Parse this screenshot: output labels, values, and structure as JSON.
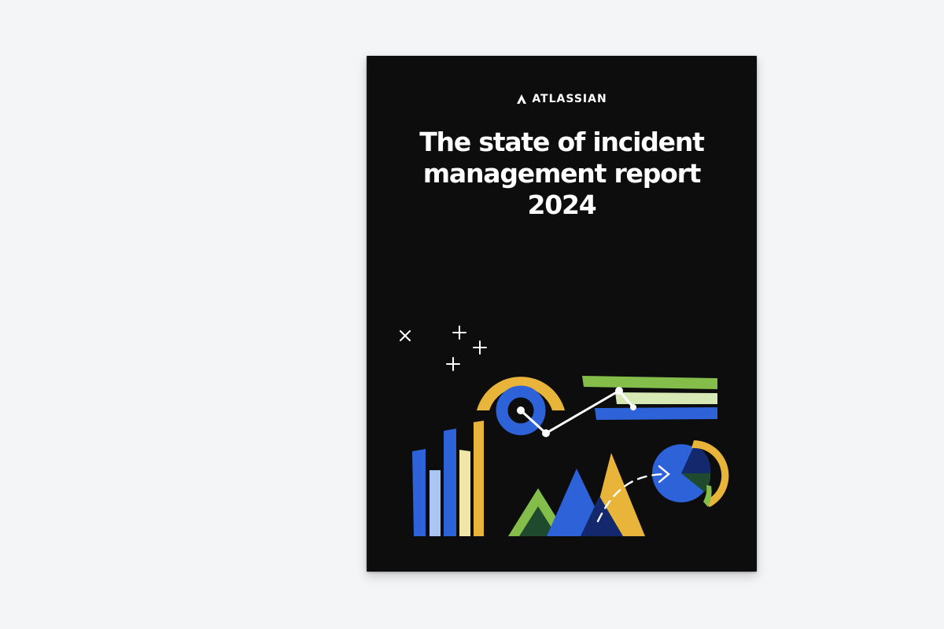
{
  "brand": {
    "name": "ATLASSIAN",
    "logo_icon": "atlassian-logo-icon"
  },
  "report": {
    "title_lines": [
      "The state of incident",
      "management report",
      "2024"
    ]
  },
  "colors": {
    "background": "#f4f5f7",
    "cover": "#0d0d0e",
    "blue": "#2d62d8",
    "light_blue": "#a9c6f2",
    "navy": "#14296d",
    "yellow": "#e8b43a",
    "cream": "#f0e6a8",
    "green": "#84bd4a",
    "light_green": "#d6e8b4",
    "dark_green": "#1f4a2e",
    "white": "#ffffff"
  }
}
